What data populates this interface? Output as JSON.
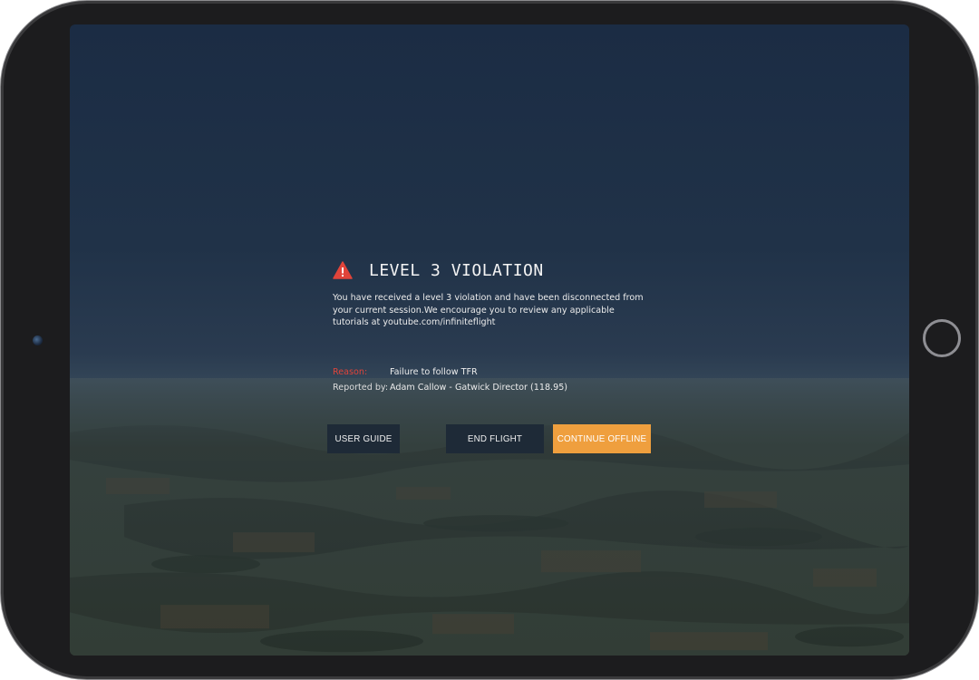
{
  "dialog": {
    "title": "LEVEL 3 VIOLATION",
    "message": "You have received a level 3 violation and have been disconnected from your current session.We encourage you to review any applicable tutorials at youtube.com/infiniteflight",
    "reason_label": "Reason:",
    "reason_value": "Failure to follow TFR",
    "reported_by_label": "Reported by:",
    "reported_by_value": "Adam Callow - Gatwick Director (118.95)"
  },
  "buttons": {
    "user_guide": "USER GUIDE",
    "end_flight": "END FLIGHT",
    "continue_offline": "CONTINUE OFFLINE"
  },
  "icons": {
    "warning": "warning-triangle-icon"
  },
  "colors": {
    "warning_red": "#e0443a",
    "reason_label": "#e0443a",
    "button_dark": "#1e2a37",
    "button_accent": "#ef9f3e",
    "sky_top": "#1b2c44",
    "horizon": "#3a4a55",
    "ground": "#3a4337"
  }
}
